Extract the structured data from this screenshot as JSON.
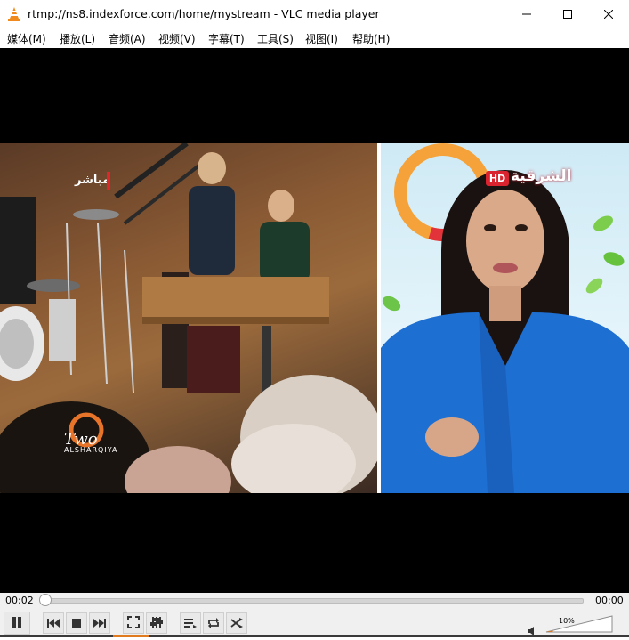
{
  "window": {
    "title": "rtmp://ns8.indexforce.com/home/mystream - VLC media player",
    "app_icon": "vlc-cone-icon",
    "controls": [
      "minimize-icon",
      "maximize-icon",
      "close-icon"
    ]
  },
  "menu": {
    "items": [
      {
        "label": "媒体(M)"
      },
      {
        "label": "播放(L)"
      },
      {
        "label": "音频(A)"
      },
      {
        "label": "视频(V)"
      },
      {
        "label": "字幕(T)"
      },
      {
        "label": "工具(S)"
      },
      {
        "label": "视图(I)"
      },
      {
        "label": "帮助(H)"
      }
    ]
  },
  "video": {
    "left_overlay": {
      "live_label": "مباشر",
      "watermark": "ALSHARQIYA"
    },
    "right_overlay": {
      "hd_badge": "HD",
      "channel_name": "الشرقية"
    }
  },
  "playback": {
    "elapsed": "00:02",
    "total": "00:00",
    "position": 0.0
  },
  "controls": {
    "buttons": [
      "pause-icon",
      "previous-icon",
      "stop-icon",
      "next-icon",
      "fullscreen-icon",
      "extended-settings-icon",
      "playlist-icon",
      "loop-icon",
      "shuffle-icon"
    ],
    "volume_percent": "10%",
    "volume_level": 0.1
  },
  "colors": {
    "vlc_orange": "#e07b20",
    "live_red": "#e0262b",
    "hd_red": "#d9232e"
  }
}
